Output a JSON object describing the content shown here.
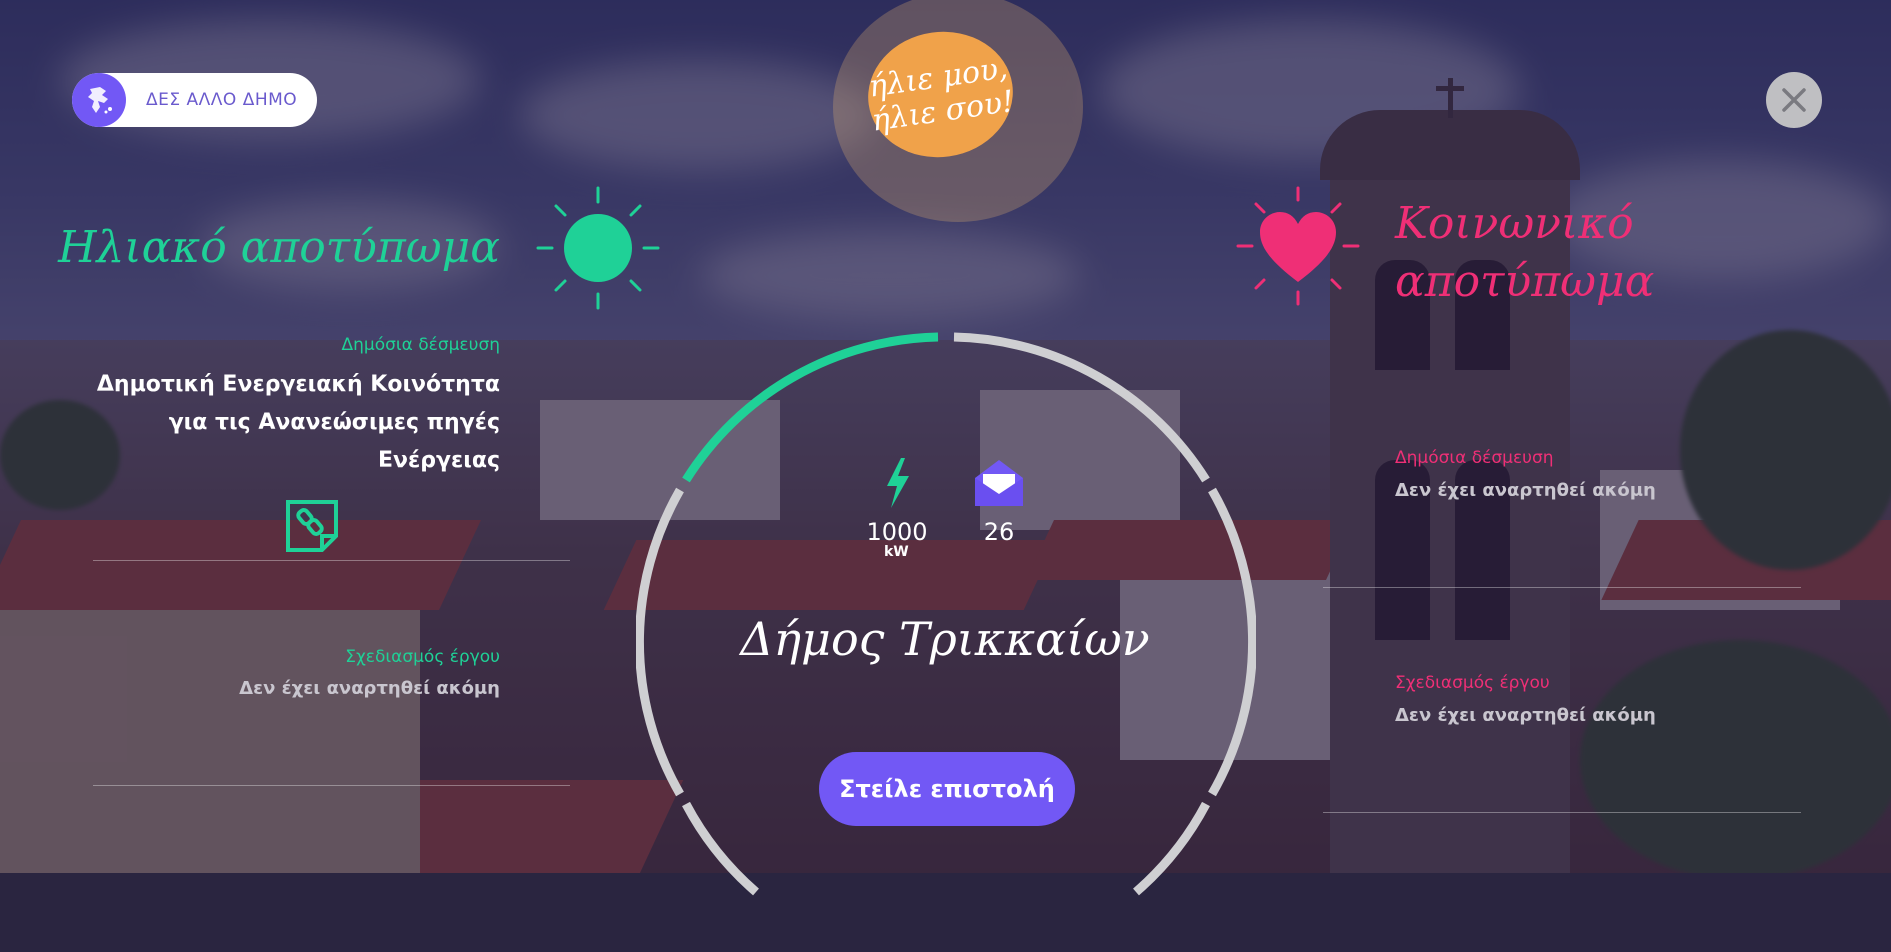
{
  "header": {
    "other_municipality_label": "ΔΕΣ ΑΛΛΟ ΔΗΜΟ",
    "logo_line1": "ήλιε μου,",
    "logo_line2": "ήλιε σου!"
  },
  "solar": {
    "title": "Ηλιακό αποτύπωμα",
    "public_commitment_label": "Δημόσια δέσμευση",
    "public_commitment_value": "Δημοτική Ενεργειακή Κοινότητα για τις Ανανεώσιμες πηγές Ενέργειας",
    "project_planning_label": "Σχεδιασμός έργου",
    "project_planning_value": "Δεν έχει αναρτηθεί ακόμη"
  },
  "social": {
    "title_line1": "Κοινωνικό",
    "title_line2": "αποτύπωμα",
    "public_commitment_label": "Δημόσια δέσμευση",
    "public_commitment_value": "Δεν έχει αναρτηθεί ακόμη",
    "project_planning_label": "Σχεδιασμός έργου",
    "project_planning_value": "Δεν έχει αναρτηθεί ακόμη"
  },
  "center": {
    "power_value": "1000",
    "power_unit": "kW",
    "letters_count": "26",
    "municipality": "Δήμος Τρικκαίων",
    "send_letter_label": "Στείλε επιστολή"
  },
  "colors": {
    "green_accent": "#1fd197",
    "pink_accent": "#ef2f76",
    "purple_button": "#7258f5",
    "logo_orange": "#f0a24a"
  },
  "icons": [
    "greece-map-icon",
    "close-icon",
    "sun-icon",
    "heart-icon",
    "document-link-icon",
    "lightning-icon",
    "envelope-icon"
  ]
}
